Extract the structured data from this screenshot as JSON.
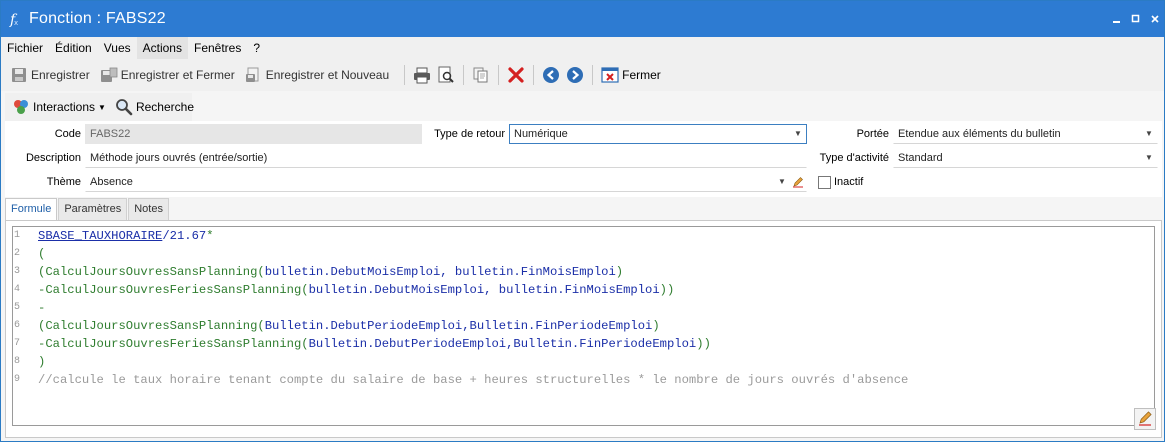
{
  "window": {
    "title": "Fonction : FABS22",
    "controls": [
      "minimize-icon",
      "maximize-icon",
      "close-icon"
    ]
  },
  "menu": {
    "items": [
      "Fichier",
      "Édition",
      "Vues",
      "Actions",
      "Fenêtres",
      "?"
    ]
  },
  "toolbar": {
    "save_label": "Enregistrer",
    "save_close_label": "Enregistrer et Fermer",
    "save_new_label": "Enregistrer et Nouveau",
    "close_label": "Fermer"
  },
  "toolbar2": {
    "interactions_label": "Interactions",
    "search_label": "Recherche"
  },
  "form": {
    "code_label": "Code",
    "code_value": "FABS22",
    "return_type_label": "Type de retour",
    "return_type_value": "Numérique",
    "scope_label": "Portée",
    "scope_value": "Etendue aux éléments du bulletin",
    "description_label": "Description",
    "description_value": "Méthode jours ouvrés (entrée/sortie)",
    "activity_type_label": "Type d'activité",
    "activity_type_value": "Standard",
    "theme_label": "Thème",
    "theme_value": "Absence",
    "inactive_label": "Inactif",
    "inactive_checked": false
  },
  "tabs": [
    "Formule",
    "Paramètres",
    "Notes"
  ],
  "active_tab": "Formule",
  "editor": {
    "line_numbers": [
      "1",
      "2",
      "3",
      "4",
      "5",
      "6",
      "7",
      "8",
      "9"
    ],
    "lines": [
      [
        {
          "t": "SBASE_TAUXHORAIRE",
          "k": "ref"
        },
        {
          "t": "/21.67",
          "k": "obj"
        },
        {
          "t": "*",
          "k": "op"
        }
      ],
      [
        {
          "t": "(",
          "k": "op"
        }
      ],
      [
        {
          "t": "(CalculJoursOuvresSansPlanning(",
          "k": "fn"
        },
        {
          "t": "bulletin.DebutMoisEmploi, bulletin.FinMoisEmploi",
          "k": "obj"
        },
        {
          "t": ")",
          "k": "fn"
        }
      ],
      [
        {
          "t": "-CalculJoursOuvresFeriesSansPlanning(",
          "k": "fn"
        },
        {
          "t": "bulletin.DebutMoisEmploi, bulletin.FinMoisEmploi",
          "k": "obj"
        },
        {
          "t": "))",
          "k": "fn"
        }
      ],
      [
        {
          "t": "-",
          "k": "op"
        }
      ],
      [
        {
          "t": "(CalculJoursOuvresSansPlanning(",
          "k": "fn"
        },
        {
          "t": "Bulletin.DebutPeriodeEmploi,Bulletin.FinPeriodeEmploi",
          "k": "obj"
        },
        {
          "t": ")",
          "k": "fn"
        }
      ],
      [
        {
          "t": "-CalculJoursOuvresFeriesSansPlanning(",
          "k": "fn"
        },
        {
          "t": "Bulletin.DebutPeriodeEmploi,Bulletin.FinPeriodeEmploi",
          "k": "obj"
        },
        {
          "t": "))",
          "k": "fn"
        }
      ],
      [
        {
          "t": ")",
          "k": "op"
        }
      ],
      [
        {
          "t": "//calcule le taux horaire tenant compte du salaire de base + heures structurelles * le nombre de jours ouvrés d'absence",
          "k": "cmt"
        }
      ]
    ]
  },
  "colors": {
    "titlebar": "#2d7bd2",
    "accent": "#3c7fc1",
    "code_function": "#2f7d2f",
    "code_object": "#1b2fa8",
    "code_comment": "#9a9a9a",
    "close_red": "#d42020"
  }
}
